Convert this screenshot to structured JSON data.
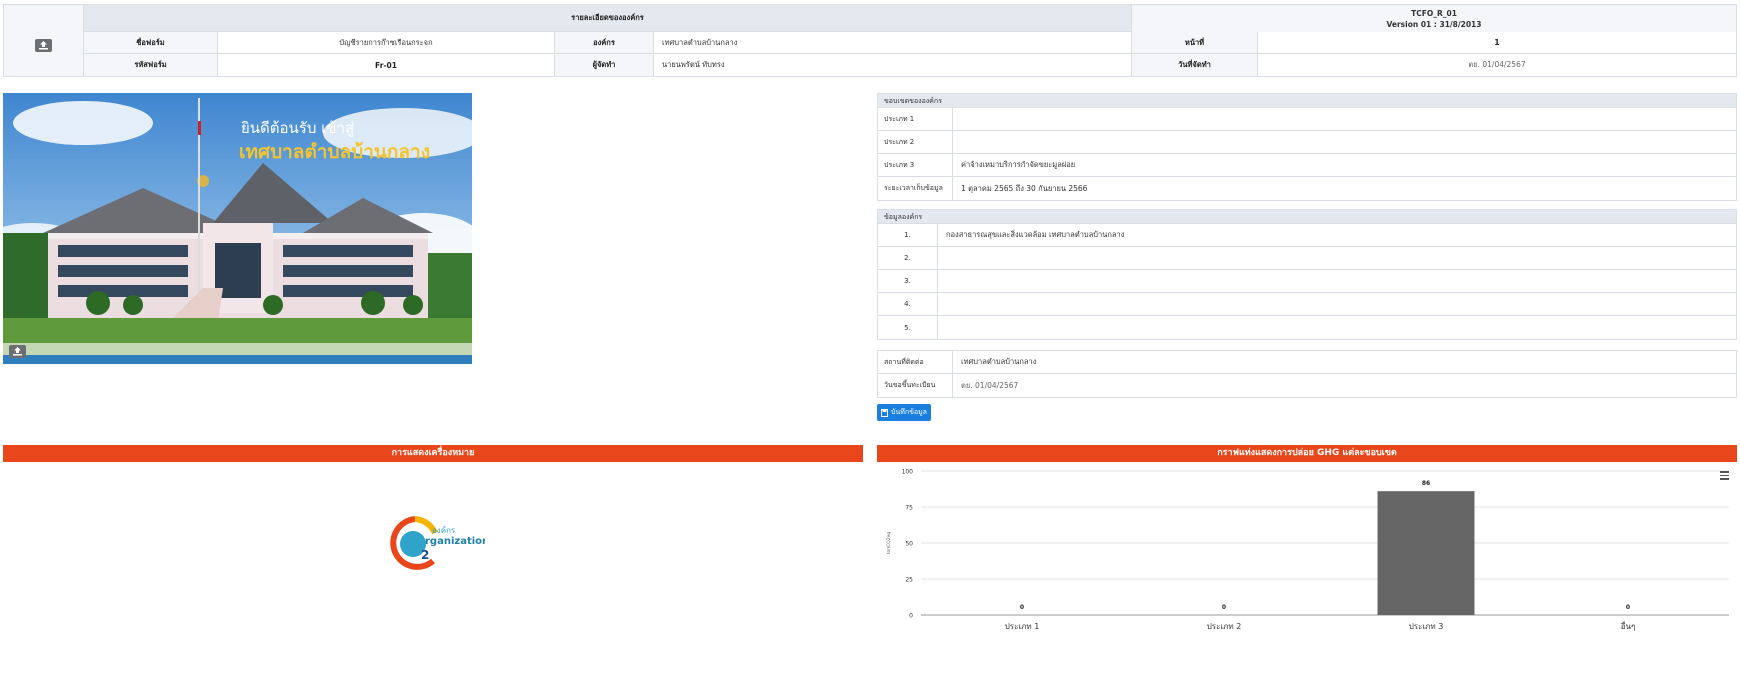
{
  "header": {
    "title": "รายละเอียดขององค์กร",
    "form_code": "TCFO_R_01",
    "version": "Version 01 : 31/8/2013",
    "row1": {
      "form_name_label": "ชื่อฟอร์ม",
      "form_name_value": "บัญชีรายการก๊าซเรือนกระจก",
      "org_label": "องค์กร",
      "org_value": "เทศบาลตำบลบ้านกลาง",
      "page_label": "หน้าที่",
      "page_value": "1"
    },
    "row2": {
      "form_code_label": "รหัสฟอร์ม",
      "form_code_value": "Fr-01",
      "preparer_label": "ผู้จัดทำ",
      "preparer_value": "นายนพรัตน์ ทับทรง",
      "date_label": "วันที่จัดทำ",
      "date_value": "ตย. 01/04/2567"
    }
  },
  "photo": {
    "caption_line1": "ยินดีต้อนรับ เข้าสู่",
    "caption_line2": "เทศบาลตำบลบ้านกลาง"
  },
  "boundary": {
    "title": "ขอบเขตขององค์กร",
    "rows": [
      {
        "label": "ประเภท 1",
        "value": ""
      },
      {
        "label": "ประเภท 2",
        "value": ""
      },
      {
        "label": "ประเภท 3",
        "value": "ค่าจ้างเหมาบริการกำจัดขยะมูลฝอย"
      },
      {
        "label": "ระยะเวลาเก็บข้อมูล",
        "value": "1 ตุลาคม 2565 ถึง 30 กันยายน 2566"
      }
    ]
  },
  "org_info": {
    "title": "ข้อมูลองค์กร",
    "rows": [
      {
        "num": "1.",
        "value": "กองสาธารณสุขและสิ่งแวดล้อม เทศบาลตำบลบ้านกลาง"
      },
      {
        "num": "2.",
        "value": ""
      },
      {
        "num": "3.",
        "value": ""
      },
      {
        "num": "4.",
        "value": ""
      },
      {
        "num": "5.",
        "value": ""
      }
    ]
  },
  "contact": {
    "rows": [
      {
        "label": "สถานที่ติดต่อ",
        "value": "เทศบาลตำบลบ้านกลาง"
      },
      {
        "label": "วันขอขึ้นทะเบียน",
        "value": "ตย. 01/04/2567"
      }
    ]
  },
  "save_button": "บันทึกข้อมูล",
  "logo_section": {
    "title": "การแสดงเครื่องหมาย",
    "logo_text1": "องค์กร",
    "logo_text2": "rganization",
    "logo_sub": "2"
  },
  "colors": {
    "accent_orange": "#e9461b",
    "button_blue": "#1a7fe0",
    "bar_gray": "#666666"
  },
  "chart_data": {
    "type": "bar",
    "title": "กราฟแท่งแสดงการปล่อย GHG แต่ละขอบเขต",
    "categories": [
      "ประเภท 1",
      "ประเภท 2",
      "ประเภท 3",
      "อื่นๆ"
    ],
    "values": [
      0,
      0,
      86,
      0
    ],
    "data_labels": [
      "0",
      "0",
      "86",
      "0"
    ],
    "ylabel": "tonCO2eq",
    "ylim": [
      0,
      100
    ],
    "yticks": [
      0,
      25,
      50,
      75,
      100
    ],
    "grid": true,
    "legend": "none"
  }
}
